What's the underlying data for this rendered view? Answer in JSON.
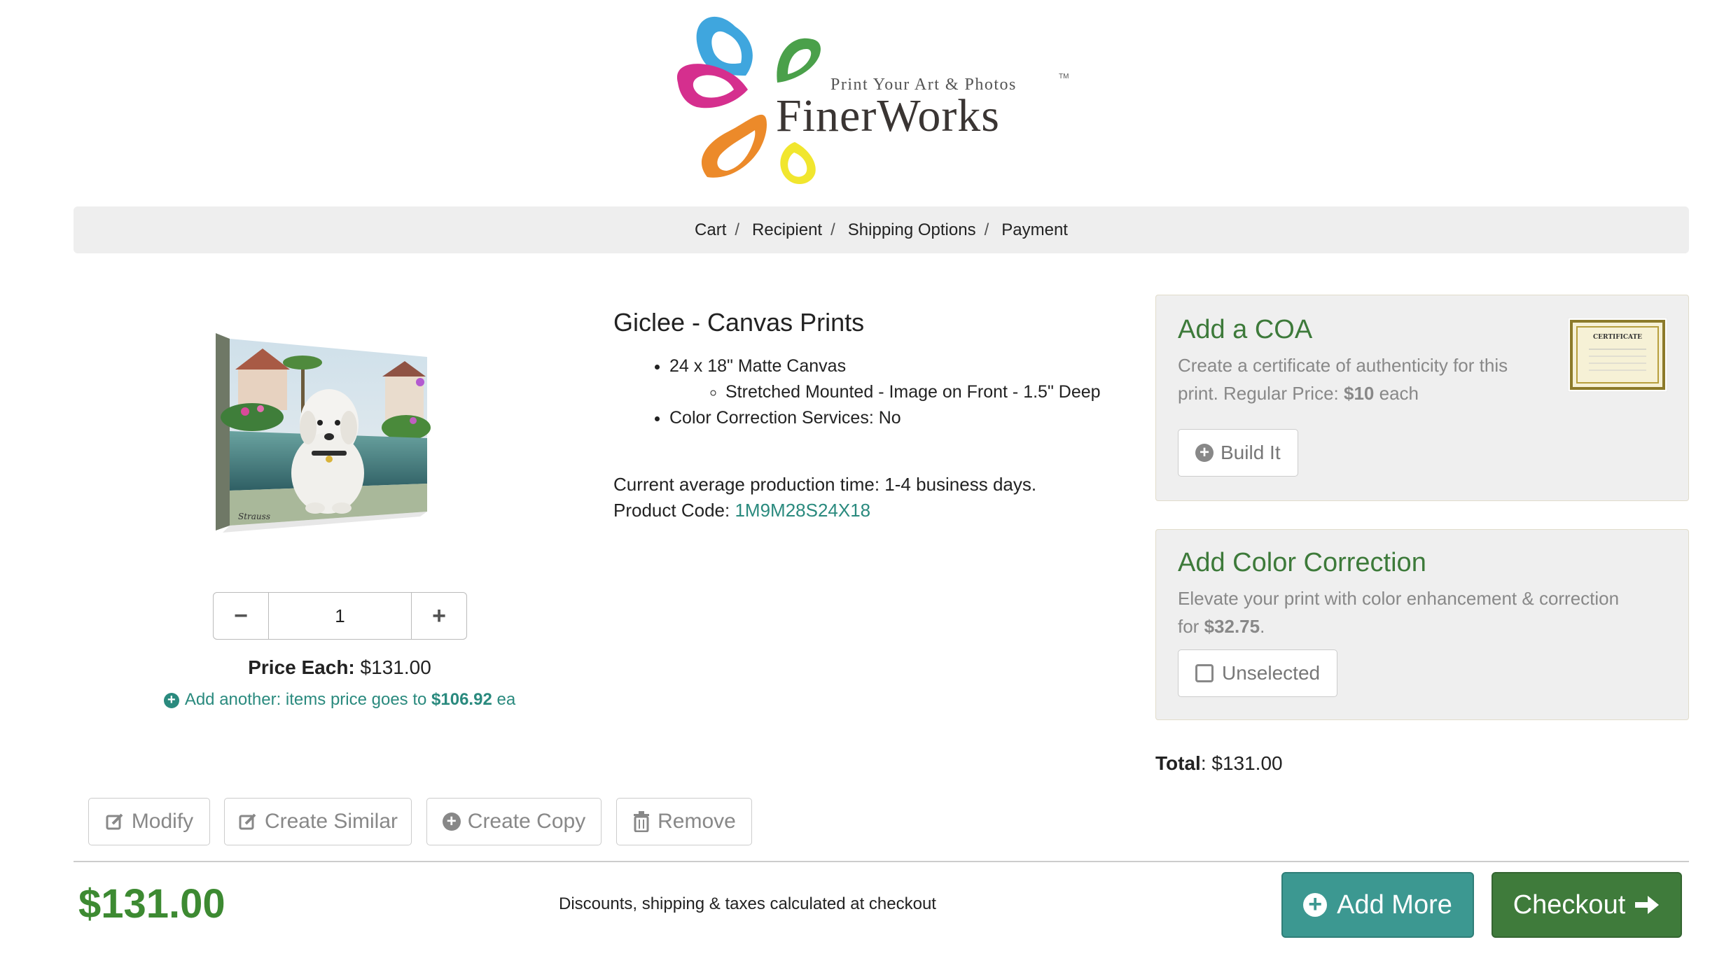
{
  "logo": {
    "tagline": "Print Your Art & Photos",
    "trademark": "TM",
    "name": "FinerWorks"
  },
  "breadcrumb": [
    "Cart",
    "Recipient",
    "Shipping Options",
    "Payment"
  ],
  "breadcrumb_separator": "/",
  "product": {
    "title": "Giclee - Canvas Prints",
    "spec": "24 x 18\" Matte Canvas",
    "spec_sub": "Stretched Mounted - Image on Front - 1.5\" Deep",
    "color_correction": "Color Correction Services: No",
    "production_time": "Current average production time: 1-4 business days.",
    "code_label": "Product Code:",
    "code": "1M9M28S24X18",
    "image_signature": "Strauss"
  },
  "quantity": {
    "value": "1",
    "minus": "−",
    "plus": "+"
  },
  "price_each": {
    "label": "Price Each:",
    "value": "$131.00"
  },
  "add_another": {
    "text": "Add another: items price goes to",
    "price": "$106.92",
    "suffix": "ea"
  },
  "coa": {
    "title": "Add a COA",
    "desc_line1": "Create a certificate of authenticity for this",
    "desc_line2_pre": "print. Regular Price:",
    "price": "$10",
    "desc_line2_post": "each",
    "button": "Build It",
    "image_text": "CERTIFICATE"
  },
  "color_correction": {
    "title": "Add Color Correction",
    "desc_line1": "Elevate your print with color enhancement & correction",
    "desc_line2_pre": "for",
    "price": "$32.75",
    "desc_line2_post": ".",
    "button": "Unselected"
  },
  "total": {
    "label": "Total",
    "value": ": $131.00"
  },
  "actions": {
    "modify": "Modify",
    "create_similar": "Create Similar",
    "create_copy": "Create Copy",
    "remove": "Remove"
  },
  "footer": {
    "grand_total": "$131.00",
    "note": "Discounts, shipping & taxes calculated at checkout",
    "add_more": "Add More",
    "checkout": "Checkout"
  },
  "colors": {
    "brand_green": "#3d7a3a",
    "teal": "#2a8a7e",
    "add_more_bg": "#3c9891",
    "checkout_bg": "#3f7b3b",
    "total_green": "#3d8a32"
  }
}
